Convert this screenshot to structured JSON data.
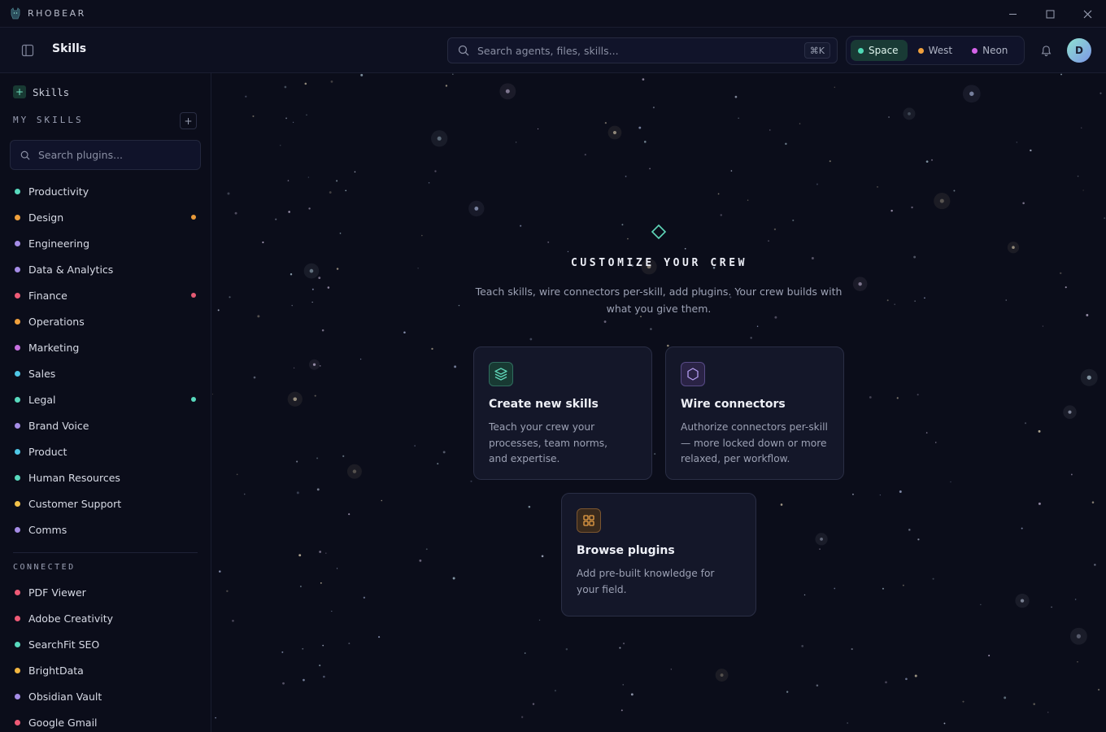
{
  "app": {
    "brand": "RHOBEAR",
    "window_controls": {
      "minimize": "—",
      "maximize": "☐",
      "close": "✕"
    }
  },
  "header": {
    "title": "Skills",
    "search_placeholder": "Search agents, files, skills...",
    "shortcut": "⌘K",
    "themes": [
      {
        "label": "Space",
        "color": "#4fd9b5",
        "active": true
      },
      {
        "label": "West",
        "color": "#f0a03c",
        "active": false
      },
      {
        "label": "Neon",
        "color": "#d463e8",
        "active": false
      }
    ],
    "avatar_initial": "D"
  },
  "sidebar": {
    "head_label": "Skills",
    "head_icon": "+",
    "my_skills_label": "MY SKILLS",
    "add_label": "+",
    "plugin_search_placeholder": "Search plugins...",
    "skills": [
      {
        "label": "Productivity",
        "color": "#58d9bd",
        "badge": null
      },
      {
        "label": "Design",
        "color": "#f0a03c",
        "badge": "#e99a3a"
      },
      {
        "label": "Engineering",
        "color": "#a58ce6",
        "badge": null
      },
      {
        "label": "Data & Analytics",
        "color": "#a58ce6",
        "badge": null
      },
      {
        "label": "Finance",
        "color": "#ee5a76",
        "badge": "#e45a73"
      },
      {
        "label": "Operations",
        "color": "#f0a03c",
        "badge": null
      },
      {
        "label": "Marketing",
        "color": "#c770e0",
        "badge": null
      },
      {
        "label": "Sales",
        "color": "#4fc7e6",
        "badge": null
      },
      {
        "label": "Legal",
        "color": "#58d9bd",
        "badge": "#58d9bd"
      },
      {
        "label": "Brand Voice",
        "color": "#a58ce6",
        "badge": null
      },
      {
        "label": "Product",
        "color": "#4fc7e6",
        "badge": null
      },
      {
        "label": "Human Resources",
        "color": "#58d9bd",
        "badge": null
      },
      {
        "label": "Customer Support",
        "color": "#f2c14a",
        "badge": null
      },
      {
        "label": "Comms",
        "color": "#a58ce6",
        "badge": null
      }
    ],
    "connected_label": "CONNECTED",
    "connected": [
      {
        "label": "PDF Viewer",
        "color": "#ee5a76"
      },
      {
        "label": "Adobe Creativity",
        "color": "#ee5a76"
      },
      {
        "label": "SearchFit SEO",
        "color": "#58d9bd"
      },
      {
        "label": "BrightData",
        "color": "#f2b640"
      },
      {
        "label": "Obsidian Vault",
        "color": "#a58ce6"
      },
      {
        "label": "Google Gmail",
        "color": "#ee5a76"
      }
    ]
  },
  "main": {
    "hero_title": "CUSTOMIZE YOUR CREW",
    "hero_subtitle": "Teach skills, wire connectors per-skill, add plugins. Your crew builds with what you give them.",
    "cards": [
      {
        "icon": "layers-icon",
        "title": "Create new skills",
        "description": "Teach your crew your processes, team norms, and expertise.",
        "accent": "#5fd6b8"
      },
      {
        "icon": "hexagon-icon",
        "title": "Wire connectors",
        "description": "Authorize connectors per-skill — more locked down or more relaxed, per workflow.",
        "accent": "#a58ce6"
      },
      {
        "icon": "grid-icon",
        "title": "Browse plugins",
        "description": "Add pre-built knowledge for your field.",
        "accent": "#e9a046"
      }
    ]
  }
}
